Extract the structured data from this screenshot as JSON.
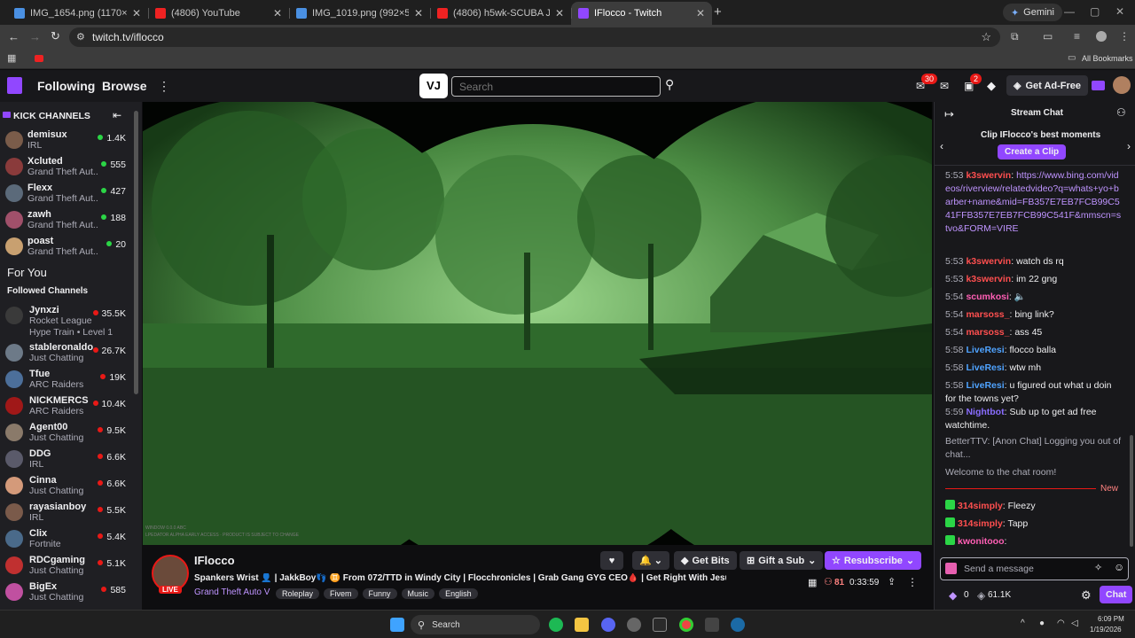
{
  "browser": {
    "tabs": [
      {
        "label": "IMG_1654.png (1170×581)",
        "active": false
      },
      {
        "label": "(4806) YouTube",
        "active": false
      },
      {
        "label": "IMG_1019.png (992×597)",
        "active": false
      },
      {
        "label": "(4806) h5wk-SCUBA JUKE(IT ST",
        "active": false
      },
      {
        "label": "IFlocco - Twitch",
        "active": true
      }
    ],
    "new_tab": "+",
    "gemini": "Gemini",
    "url": "twitch.tv/iflocco",
    "bookmarks": "All Bookmarks"
  },
  "topnav": {
    "following": "Following",
    "browse": "Browse",
    "search_placeholder": "Search",
    "inbox_count": "30",
    "whispers_count": "2",
    "ad_free": "Get Ad-Free"
  },
  "sidebar": {
    "kick_header": "KICK CHANNELS",
    "kick_channels": [
      {
        "name": "demisux",
        "game": "IRL",
        "viewers": "1.4K",
        "color": "#7a5c4a"
      },
      {
        "name": "Xcluted",
        "game": "Grand Theft Aut...",
        "viewers": "555",
        "color": "#8a3b3b"
      },
      {
        "name": "Flexx",
        "game": "Grand Theft Aut...",
        "viewers": "427",
        "color": "#5b6a7a"
      },
      {
        "name": "zawh",
        "game": "Grand Theft Aut...",
        "viewers": "188",
        "color": "#a0506a"
      },
      {
        "name": "poast",
        "game": "Grand Theft Aut...",
        "viewers": "20",
        "color": "#c8a070"
      }
    ],
    "for_you": "For You",
    "followed_header": "Followed Channels",
    "followed": [
      {
        "name": "Jynxzi",
        "game": "Rocket League",
        "viewers": "35.5K",
        "extra": "Hype Train • Level 1",
        "color": "#3a3a3a"
      },
      {
        "name": "stableronaldo",
        "game": "Just Chatting",
        "viewers": "26.7K",
        "color": "#6d7a88"
      },
      {
        "name": "Tfue",
        "game": "ARC Raiders",
        "viewers": "19K",
        "color": "#4c6f9a"
      },
      {
        "name": "NICKMERCS",
        "game": "ARC Raiders",
        "viewers": "10.4K",
        "color": "#a01818"
      },
      {
        "name": "Agent00",
        "game": "Just Chatting",
        "viewers": "9.5K",
        "color": "#8a7a6a"
      },
      {
        "name": "DDG",
        "game": "IRL",
        "viewers": "6.6K",
        "color": "#5a5a6a"
      },
      {
        "name": "Cinna",
        "game": "Just Chatting",
        "viewers": "6.6K",
        "color": "#d49a7a"
      },
      {
        "name": "rayasianboy",
        "game": "IRL",
        "viewers": "5.5K",
        "color": "#7a5a4a"
      },
      {
        "name": "Clix",
        "game": "Fortnite",
        "viewers": "5.4K",
        "color": "#4a6a8a"
      },
      {
        "name": "RDCgaming",
        "game": "Just Chatting",
        "viewers": "5.1K",
        "color": "#c03030"
      },
      {
        "name": "BigEx",
        "game": "Just Chatting",
        "viewers": "585",
        "color": "#c050a0"
      }
    ]
  },
  "stream": {
    "channel": "IFlocco",
    "live": "LIVE",
    "title": "Spankers Wrist 👤 | JakkBoy👣 ♊ From 072/TTD in Windy City | Flocchronicles | Grab Gang GYG CEO🩸 | Get Right With Jesus 🙏🎀",
    "game": "Grand Theft Auto V",
    "tags": [
      "Roleplay",
      "Fivem",
      "Funny",
      "Music",
      "English"
    ],
    "viewers": "81",
    "uptime": "0:33:59",
    "get_bits": "Get Bits",
    "gift_sub": "Gift a Sub",
    "resubscribe": "Resubscribe",
    "video_overlay_1": "WINDOW 0.0.0 ABC",
    "video_overlay_2": "LPEDATOR ALPHA EARLY ACCESS · PRODUCT IS SUBJECT TO CHANGE"
  },
  "chat": {
    "header": "Stream Chat",
    "clip_title": "Clip IFlocco's best moments",
    "create_clip": "Create a Clip",
    "messages": [
      {
        "time": "5:53",
        "user": "k3swervin",
        "color": "#ff4f4f",
        "text": "https://www.bing.com/videos/riverview/relatedvideo?q=whats+yo+barber+name&mid=FB357E7EB7FCB99C541FFB357E7EB7FCB99C541F&mmscn=stvo&FORM=VIRE",
        "link": true
      },
      {
        "time": "5:53",
        "user": "k3swervin",
        "color": "#ff4f4f",
        "text": "watch ds rq"
      },
      {
        "time": "5:53",
        "user": "k3swervin",
        "color": "#ff4f4f",
        "text": "im 22 gng"
      },
      {
        "time": "5:54",
        "user": "scumkosi",
        "color": "#ff5fb5",
        "text": "🔈"
      },
      {
        "time": "5:54",
        "user": "marsoss_",
        "color": "#ff4f4f",
        "text": "bing link?"
      },
      {
        "time": "5:54",
        "user": "marsoss_",
        "color": "#ff4f4f",
        "text": "ass 45"
      },
      {
        "time": "5:58",
        "user": "LiveResi",
        "color": "#4fa3ff",
        "text": "flocco balla"
      },
      {
        "time": "5:58",
        "user": "LiveResi",
        "color": "#4fa3ff",
        "text": "wtw mh"
      },
      {
        "time": "5:58",
        "user": "LiveResi",
        "color": "#4fa3ff",
        "text": "u figured out what u doin for the towns yet?"
      },
      {
        "time": "5:59",
        "user": "Nightbot",
        "color": "#8a6dff",
        "text": "Sub up to get ad free watchtime."
      }
    ],
    "system_1": "BetterTTV: [Anon Chat] Logging you out of chat...",
    "system_2": "Welcome to the chat room!",
    "new_label": "New",
    "new_messages": [
      {
        "user": "314simply",
        "color": "#ff4f4f",
        "text": "Fleezy"
      },
      {
        "user": "314simply",
        "color": "#ff4f4f",
        "text": "Tapp"
      },
      {
        "user": "kwonitooo",
        "color": "#ff5fb5",
        "text": ""
      }
    ],
    "input_placeholder": "Send a message",
    "points": "0",
    "channel_points": "61.1K",
    "chat_button": "Chat"
  },
  "taskbar": {
    "search": "Search",
    "time": "6:09 PM",
    "date": "1/19/2026"
  }
}
